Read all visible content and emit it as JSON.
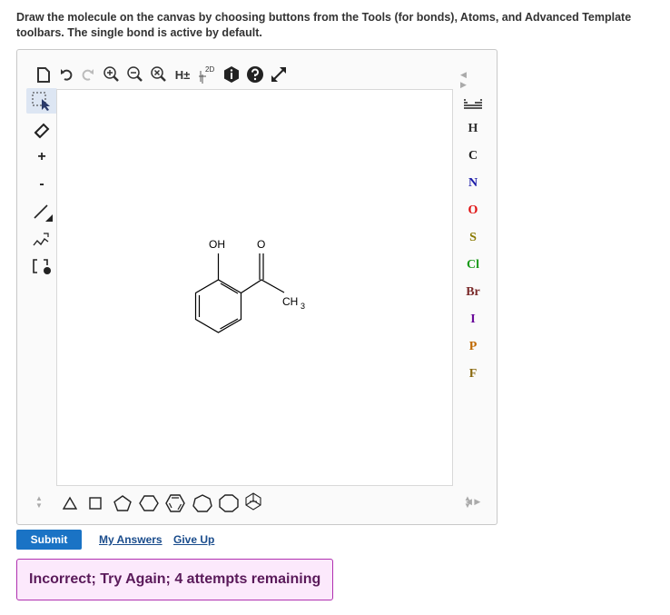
{
  "instructions": "Draw the molecule on the canvas by choosing buttons from the Tools (for bonds), Atoms, and Advanced Template toolbars. The single bond is active by default.",
  "top_toolbar": {
    "icons": [
      "new-document-icon",
      "undo-icon",
      "redo-icon",
      "zoom-in-icon",
      "zoom-out-icon",
      "clear-icon",
      "hydrogens-toggle",
      "2d-clean-icon",
      "info-icon",
      "help-icon",
      "fullscreen-icon"
    ],
    "hydrogens_label": "H±",
    "clean_label": "2D"
  },
  "left_toolbar": {
    "items": [
      "select-tool",
      "eraser-tool",
      "charge-plus-tool",
      "charge-minus-tool",
      "single-bond-tool",
      "chain-tool",
      "bracket-tool"
    ],
    "plus_label": "+",
    "minus_label": "-"
  },
  "atoms": [
    {
      "symbol": "H",
      "color": "#333333"
    },
    {
      "symbol": "C",
      "color": "#222222"
    },
    {
      "symbol": "N",
      "color": "#1a1aa8"
    },
    {
      "symbol": "O",
      "color": "#e01010"
    },
    {
      "symbol": "S",
      "color": "#8a7a00"
    },
    {
      "symbol": "Cl",
      "color": "#1a9a1a"
    },
    {
      "symbol": "Br",
      "color": "#7a2a2a"
    },
    {
      "symbol": "I",
      "color": "#6a0a9a"
    },
    {
      "symbol": "P",
      "color": "#c06a00"
    },
    {
      "symbol": "F",
      "color": "#8a6a10"
    }
  ],
  "templates": [
    "triangle",
    "square",
    "pentagon",
    "hexagon-flat",
    "benzene",
    "heptagon",
    "octagon",
    "adamantane"
  ],
  "molecule": {
    "labels": {
      "oh": "OH",
      "o": "O",
      "ch3": "CH",
      "ch3_sub": "3"
    }
  },
  "actions": {
    "submit": "Submit",
    "my_answers": "My Answers",
    "give_up": "Give Up"
  },
  "feedback": "Incorrect; Try Again; 4 attempts remaining"
}
